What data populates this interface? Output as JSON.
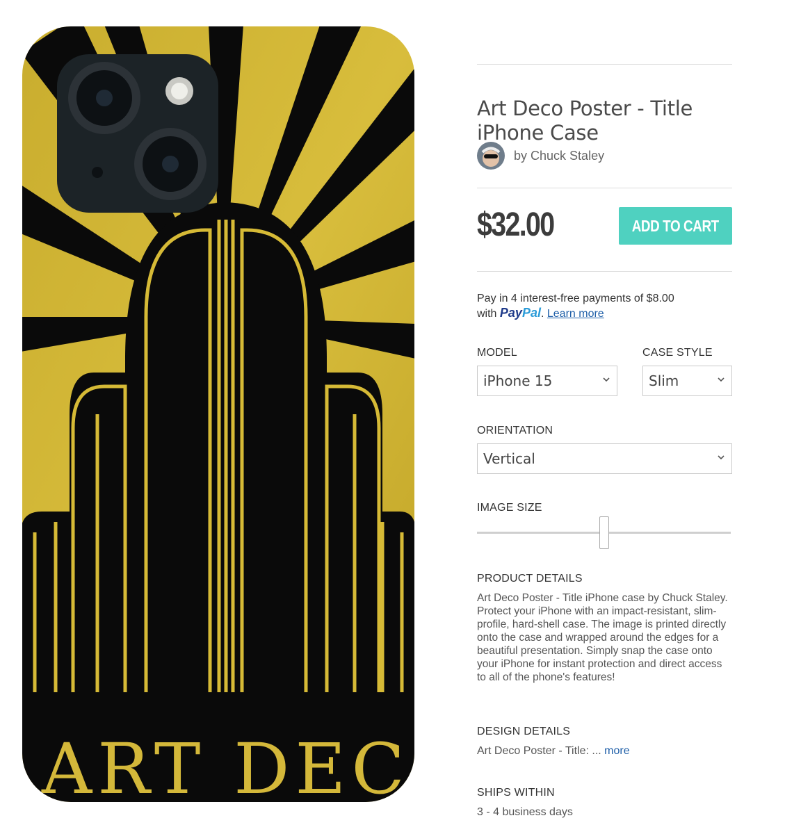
{
  "product": {
    "title": "Art Deco Poster - Title iPhone Case",
    "author_prefix": "by",
    "author_name": "Chuck Staley",
    "price": "$32.00",
    "add_to_cart_label": "ADD TO CART"
  },
  "paypal": {
    "line1": "Pay in 4 interest-free payments of $8.00",
    "line2_prefix": "with",
    "logo_pay": "Pay",
    "logo_pal": "Pal",
    "punct": ".",
    "learn_more": "Learn more"
  },
  "options": {
    "model_label": "MODEL",
    "model_value": "iPhone 15",
    "case_style_label": "CASE STYLE",
    "case_style_value": "Slim",
    "orientation_label": "ORIENTATION",
    "orientation_value": "Vertical",
    "image_size_label": "IMAGE SIZE",
    "image_size_level": 0.5
  },
  "details": {
    "product_label": "PRODUCT DETAILS",
    "product_text": "Art Deco Poster - Title iPhone case by Chuck Staley.   Protect your iPhone with an impact-resistant, slim-profile, hard-shell case. The image is printed directly onto the case and wrapped around the edges for a beautiful presentation. Simply snap the case onto your iPhone for instant protection and direct access to all of the phone's features!",
    "design_label": "DESIGN DETAILS",
    "design_text": "Art Deco Poster - Title: ...",
    "design_more": "more",
    "ships_label": "SHIPS WITHIN",
    "ships_text": "3 - 4 business days"
  },
  "artwork": {
    "text": "ART DECO",
    "colors": {
      "gold": "#d1b431",
      "black": "#0a0a0a",
      "camera": "#1c2327"
    }
  },
  "colors": {
    "accent": "#4fd1c0",
    "link": "#1f5fa8"
  }
}
